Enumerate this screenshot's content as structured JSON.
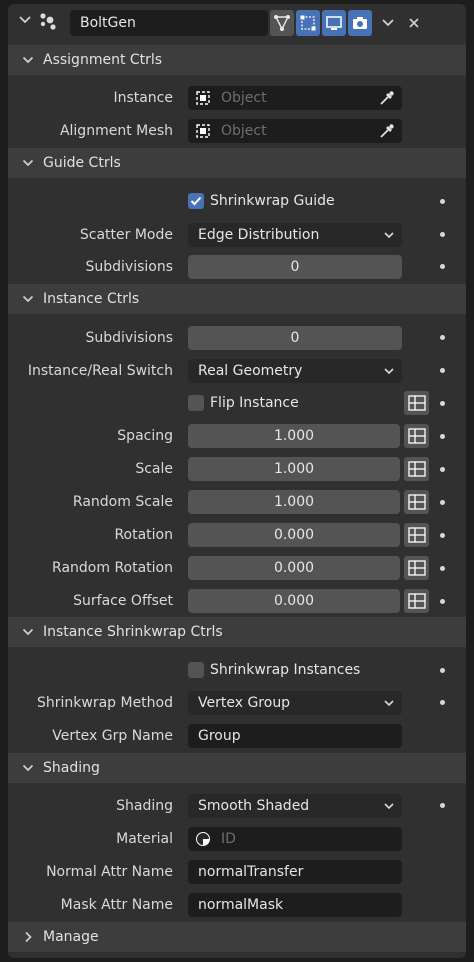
{
  "header": {
    "object_name": "BoltGen"
  },
  "sections": {
    "assignment": "Assignment Ctrls",
    "guide": "Guide Ctrls",
    "instance": "Instance Ctrls",
    "shrinkwrap": "Instance Shrinkwrap Ctrls",
    "shading": "Shading",
    "manage": "Manage"
  },
  "assignment": {
    "instance_label": "Instance",
    "instance_placeholder": "Object",
    "alignment_label": "Alignment Mesh",
    "alignment_placeholder": "Object"
  },
  "guide": {
    "shrinkwrap_guide_label": "Shrinkwrap Guide",
    "shrinkwrap_guide_checked": true,
    "scatter_mode_label": "Scatter Mode",
    "scatter_mode_value": "Edge Distribution",
    "subdivisions_label": "Subdivisions",
    "subdivisions_value": "0"
  },
  "instance": {
    "subdivisions_label": "Subdivisions",
    "subdivisions_value": "0",
    "switch_label": "Instance/Real Switch",
    "switch_value": "Real Geometry",
    "flip_label": "Flip Instance",
    "flip_checked": false,
    "spacing_label": "Spacing",
    "spacing_value": "1.000",
    "scale_label": "Scale",
    "scale_value": "1.000",
    "random_scale_label": "Random Scale",
    "random_scale_value": "1.000",
    "rotation_label": "Rotation",
    "rotation_value": "0.000",
    "random_rotation_label": "Random Rotation",
    "random_rotation_value": "0.000",
    "surface_offset_label": "Surface Offset",
    "surface_offset_value": "0.000"
  },
  "shrinkwrap": {
    "instances_label": "Shrinkwrap Instances",
    "instances_checked": false,
    "method_label": "Shrinkwrap Method",
    "method_value": "Vertex Group",
    "vgroup_label": "Vertex Grp Name",
    "vgroup_value": "Group"
  },
  "shading": {
    "shading_label": "Shading",
    "shading_value": "Smooth Shaded",
    "material_label": "Material",
    "material_placeholder": "ID",
    "normal_attr_label": "Normal Attr Name",
    "normal_attr_value": "normalTransfer",
    "mask_attr_label": "Mask Attr Name",
    "mask_attr_value": "normalMask"
  },
  "colors": {
    "accent": "#4772b3",
    "panel": "#303030",
    "section_header": "#3d3d3d",
    "field_dark": "#1d1d1d",
    "field_grey": "#545454"
  },
  "icons": [
    "chevron-down-icon",
    "node-dots-icon",
    "geometry-nodes-icon",
    "select-icon",
    "viewport-icon",
    "camera-icon",
    "close-icon",
    "object-icon",
    "eyedropper-icon",
    "keyframe-toggle-icon",
    "material-icon",
    "chevron-right-icon"
  ]
}
